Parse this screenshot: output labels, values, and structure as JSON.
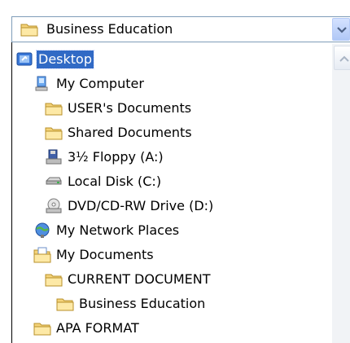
{
  "combo": {
    "value": "Business Education",
    "icon": "folder-icon"
  },
  "dropdown": {
    "selected_index": 0,
    "items": [
      {
        "label": "Desktop",
        "icon": "desktop-icon"
      },
      {
        "label": "My Computer",
        "icon": "my-computer-icon"
      },
      {
        "label": "USER's Documents",
        "icon": "folder-icon"
      },
      {
        "label": "Shared Documents",
        "icon": "folder-icon"
      },
      {
        "label": "3½ Floppy (A:)",
        "icon": "floppy-drive-icon"
      },
      {
        "label": "Local Disk (C:)",
        "icon": "hard-disk-icon"
      },
      {
        "label": "DVD/CD-RW Drive (D:)",
        "icon": "dvd-drive-icon"
      },
      {
        "label": "My Network Places",
        "icon": "network-places-icon"
      },
      {
        "label": "My Documents",
        "icon": "my-documents-icon"
      },
      {
        "label": "CURRENT DOCUMENT",
        "icon": "folder-icon"
      },
      {
        "label": "Business Education",
        "icon": "folder-icon"
      },
      {
        "label": "APA FORMAT",
        "icon": "folder-icon"
      }
    ]
  },
  "colors": {
    "selection": "#316ac5",
    "folder": "#f4d37a",
    "border": "#7f9db9"
  }
}
